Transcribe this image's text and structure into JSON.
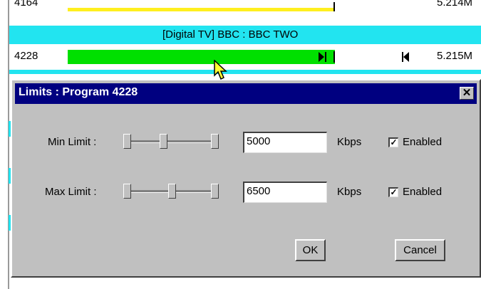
{
  "monitor": {
    "rows": [
      {
        "pid": "4164",
        "rate": "5.214M",
        "bar_fill": 0.555
      },
      {
        "pid": "4228",
        "rate": "5.215M",
        "bar_fill": 0.555
      }
    ],
    "service_label": "[Digital TV] BBC : BBC TWO",
    "colors": {
      "yellow": "#ffef1f",
      "green": "#00e000",
      "cyan": "#22e4f0"
    }
  },
  "dialog": {
    "title": "Limits : Program 4228",
    "close_glyph": "✕",
    "min": {
      "label": "Min Limit :",
      "value": "5000",
      "unit": "Kbps",
      "enabled_label": "Enabled",
      "enabled": true,
      "slider_level": 0.38
    },
    "max": {
      "label": "Max Limit :",
      "value": "6500",
      "unit": "Kbps",
      "enabled_label": "Enabled",
      "enabled": true,
      "slider_level": 0.5
    },
    "ok_label": "OK",
    "cancel_label": "Cancel",
    "colors": {
      "title_bg": "#000080",
      "face": "#c0c0c0"
    }
  }
}
